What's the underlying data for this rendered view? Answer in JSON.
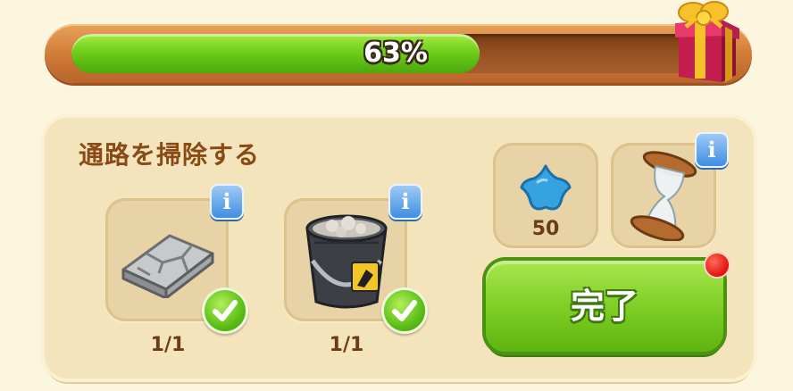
{
  "progress": {
    "percent": 63,
    "label": "63%"
  },
  "task": {
    "title": "通路を掃除する",
    "items": [
      {
        "icon": "stone-tile-icon",
        "count": "1/1",
        "completed": true
      },
      {
        "icon": "bucket-icon",
        "count": "1/1",
        "completed": true
      }
    ]
  },
  "reward": {
    "star": {
      "icon": "blue-star-icon",
      "amount": "50"
    },
    "timer": {
      "icon": "hourglass-icon"
    }
  },
  "actions": {
    "complete_label": "完了"
  },
  "icons": {
    "info": "i"
  },
  "colors": {
    "progress_green": "#6fcf19",
    "button_green": "#7fcf26",
    "info_blue": "#3f8ee2",
    "title_brown": "#8a4a17",
    "notification_red": "#e0140d"
  }
}
